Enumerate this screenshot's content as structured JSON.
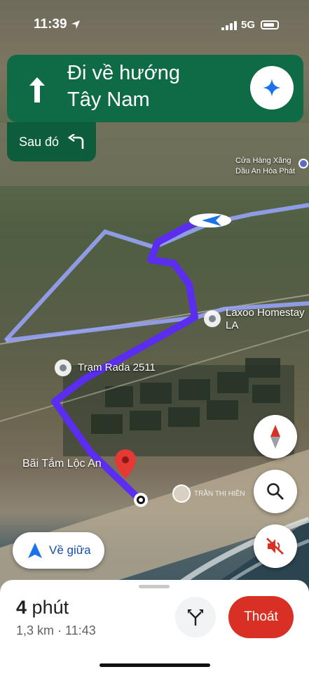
{
  "status_bar": {
    "time": "11:39",
    "network": "5G"
  },
  "navigation": {
    "instruction_line1": "Đi về hướng",
    "instruction_line2": "Tây Nam",
    "then_label": "Sau đó"
  },
  "map": {
    "labels": {
      "gas_station_line1": "Cửa Hàng Xăng",
      "gas_station_line2": "Dầu An Hòa Phát",
      "homestay_line1": "Laxoo Homestay",
      "homestay_line2": "LA",
      "radar": "Trạm Rada 2511",
      "beach": "Bãi Tắm Lộc An",
      "user_name": "TRẦN THỊ HIỀN"
    },
    "colors": {
      "route": "#5b2df0",
      "alt_route": "#9aa6ff",
      "destination_pin": "#e53935"
    }
  },
  "controls": {
    "recenter_label": "Về giữa",
    "compass": "compass-icon",
    "search": "search-icon",
    "sound": "sound-muted-icon"
  },
  "trip": {
    "eta_value": "4",
    "eta_unit": "phút",
    "details": "1,3 km · 11:43",
    "exit_label": "Thoát"
  }
}
